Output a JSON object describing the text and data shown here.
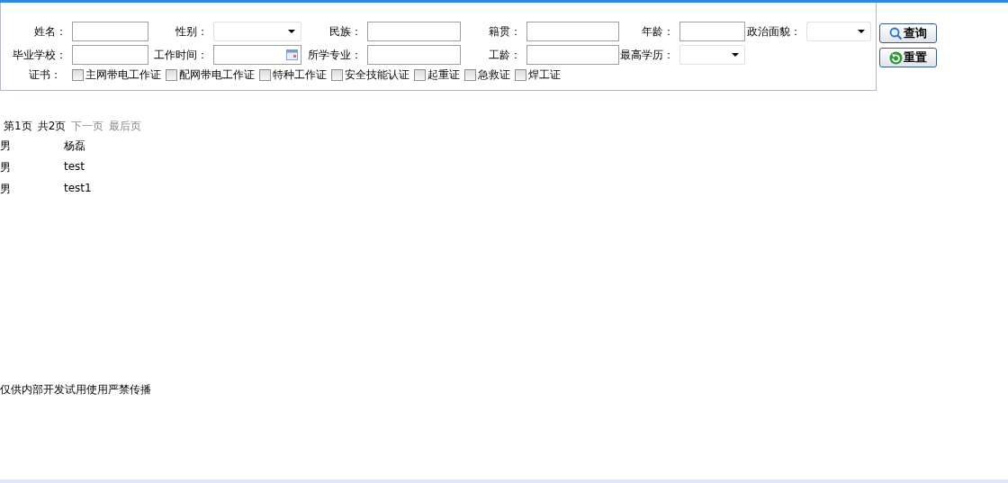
{
  "search_form": {
    "fields": [
      {
        "label": "姓名：",
        "kind": "text"
      },
      {
        "label": "性别：",
        "kind": "select"
      },
      {
        "label": "民族：",
        "kind": "text"
      },
      {
        "label": "籍贯：",
        "kind": "text"
      },
      {
        "label": "年龄：",
        "kind": "text"
      },
      {
        "label": "政治面貌：",
        "kind": "select"
      },
      {
        "label": "毕业学校：",
        "kind": "text"
      },
      {
        "label": "工作时间：",
        "kind": "date"
      },
      {
        "label": "所学专业：",
        "kind": "text"
      },
      {
        "label": "工龄：",
        "kind": "text"
      },
      {
        "label": "最高学历：",
        "kind": "select"
      }
    ],
    "certificates": {
      "label": "证书：",
      "options": [
        {
          "label": "主网带电工作证",
          "checked": false
        },
        {
          "label": "配网带电工作证",
          "checked": false
        },
        {
          "label": "特种工作证",
          "checked": false
        },
        {
          "label": "安全技能认证",
          "checked": false
        },
        {
          "label": "起重证",
          "checked": false
        },
        {
          "label": "急救证",
          "checked": false
        },
        {
          "label": "焊工证",
          "checked": false
        }
      ]
    }
  },
  "buttons": [
    {
      "label": "查询",
      "kind": "search"
    },
    {
      "label": "重置",
      "kind": "reset"
    }
  ],
  "pager": [
    {
      "label": "第1页",
      "disabled": false
    },
    {
      "label": "共2页",
      "disabled": false
    },
    {
      "label": "下一页",
      "disabled": true
    },
    {
      "label": "最后页",
      "disabled": true
    }
  ],
  "rows": [
    {
      "gender": "男",
      "name": "杨磊"
    },
    {
      "gender": "男",
      "name": "test"
    },
    {
      "gender": "男",
      "name": "test1"
    }
  ],
  "footer": "仅供内部开发试用使用严禁传播"
}
